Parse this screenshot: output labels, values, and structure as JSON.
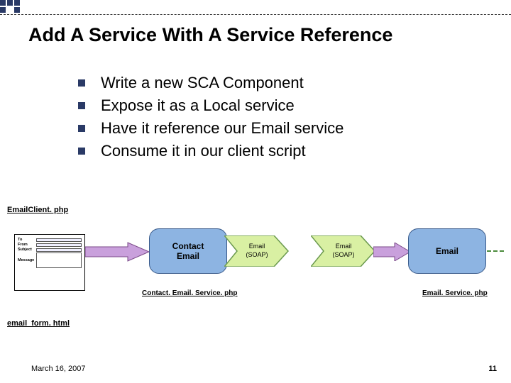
{
  "title": "Add A Service With A Service Reference",
  "bullets": [
    "Write a new SCA Component",
    "Expose it as a Local service",
    "Have it reference our Email service",
    "Consume it in our client script"
  ],
  "labels": {
    "email_client": "EmailClient. php",
    "contact_service": "Contact. Email. Service. php",
    "email_service": "Email. Service. php",
    "email_form": "email_form. html"
  },
  "form_fields": {
    "to": "To",
    "from": "From",
    "subject": "Subject",
    "message": "Message"
  },
  "components": {
    "contact_email": "Contact\nEmail",
    "email": "Email"
  },
  "chevrons": {
    "email_soap_1": "Email\n(SOAP)",
    "email_soap_2": "Email\n(SOAP)"
  },
  "footer": {
    "date": "March 16, 2007",
    "page": "11"
  },
  "colors": {
    "bullet": "#2a3a66",
    "component": "#8db4e2",
    "chevron_fill": "#d9f0a3",
    "chevron_stroke": "#6a994e",
    "arrow_fill": "#c9a0dc",
    "arrow_stroke": "#7a4988"
  }
}
